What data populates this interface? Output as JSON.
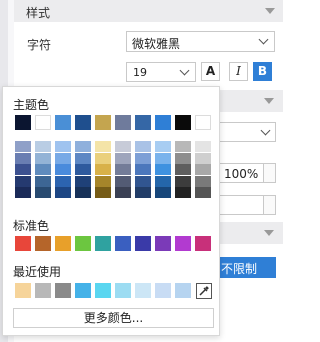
{
  "panel": {
    "section_title": "样式",
    "font_label": "字符",
    "font_value": "微软雅黑",
    "size_value": "19",
    "bold_label": "A",
    "italic_label": "I",
    "b_label": "B",
    "percent_value": "100%",
    "limit_label": "不限制"
  },
  "popup": {
    "theme_label": "主题色",
    "standard_label": "标准色",
    "recent_label": "最近使用",
    "more_label": "更多颜色...",
    "theme_top": [
      "#0b1530",
      "#ffffff",
      "#4a8fd6",
      "#1f4f8e",
      "#c4a54f",
      "#6f7b9c",
      "#3567a6",
      "#2f7fd6",
      "#0a0a0a",
      "#ffffff"
    ],
    "theme_columns": [
      [
        "#8fa0c8",
        "#6a7eb2",
        "#3c5190",
        "#253a70",
        "#1a2a58"
      ],
      [
        "#b9cde4",
        "#93b3d6",
        "#5f8bbd",
        "#3d6694",
        "#284a70"
      ],
      [
        "#9fc3ef",
        "#77a9e6",
        "#4a8bdc",
        "#2c64b0",
        "#1d4684"
      ],
      [
        "#8fb0dc",
        "#5d87c4",
        "#2e5a9e",
        "#1f4178",
        "#173158"
      ],
      [
        "#f4e4a8",
        "#ead07c",
        "#d8b149",
        "#a6852a",
        "#765c17"
      ],
      [
        "#c7cbd8",
        "#9ea5bc",
        "#737c98",
        "#535b74",
        "#3a4054"
      ],
      [
        "#a9c2e6",
        "#7d9fd6",
        "#4c77bc",
        "#315590",
        "#223d68"
      ],
      [
        "#a8cdf2",
        "#7ab3ec",
        "#3f92e0",
        "#2466aa",
        "#17467a"
      ],
      [
        "#b8b8b8",
        "#8e8e8e",
        "#5e5e5e",
        "#3c3c3c",
        "#222222"
      ],
      [
        "#e4e4e4",
        "#cfcfcf",
        "#a8a8a8",
        "#7a7a7a",
        "#555555"
      ]
    ],
    "standard": [
      "#e8463a",
      "#b5652a",
      "#e8a02a",
      "#6cc640",
      "#2fa2a0",
      "#3a5fc0",
      "#3a3aa8",
      "#7b3ab8",
      "#b23ad0",
      "#c8307a"
    ],
    "recent": [
      "#f6d49a",
      "#b8b8b8",
      "#8a8a8a",
      "#45b2e8",
      "#5ad6f0",
      "#9cdcf2",
      "#cce6f6",
      "#c8dcf4",
      "#b6d4f0"
    ]
  }
}
